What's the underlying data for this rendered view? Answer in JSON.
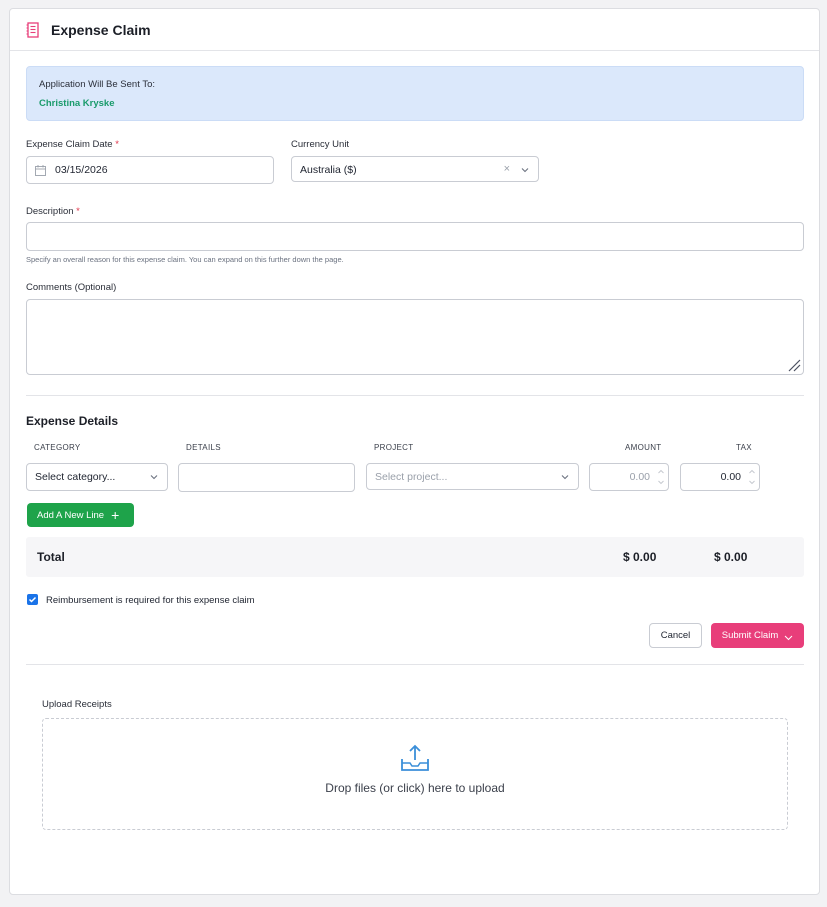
{
  "header": {
    "title": "Expense Claim",
    "icon": "receipt-icon"
  },
  "notice": {
    "label": "Application Will Be Sent To:",
    "recipient": "Christina Kryske"
  },
  "form": {
    "claim_date_label": "Expense Claim Date",
    "required_mark": "*",
    "claim_date_value": "03/15/2026",
    "currency_label": "Currency Unit",
    "currency_value": "Australia ($)",
    "clear_symbol": "×",
    "description_label": "Description",
    "description_value": "",
    "description_help": "Specify an overall reason for this expense claim. You can expand on this further down the page.",
    "comments_label": "Comments (Optional)",
    "comments_value": ""
  },
  "expense_details": {
    "title": "Expense Details",
    "columns": [
      "CATEGORY",
      "DETAILS",
      "PROJECT",
      "AMOUNT",
      "TAX"
    ],
    "row": {
      "category_placeholder": "Select category...",
      "details_value": "",
      "project_placeholder": "Select project...",
      "amount_value": "0.00",
      "tax_value": "0.00"
    },
    "add_line_label": "Add A New Line",
    "total_label": "Total",
    "total_amount": "$ 0.00",
    "total_tax": "$ 0.00"
  },
  "reimbursement": {
    "label": "Reimbursement is required for this expense claim",
    "checked": true
  },
  "actions": {
    "cancel_label": "Cancel",
    "submit_label": "Submit Claim"
  },
  "upload": {
    "label": "Upload Receipts",
    "dropzone_text": "Drop files (or click) here to upload"
  },
  "colors": {
    "accent_pink": "#e83e7a",
    "accent_green": "#1ea34a",
    "link_green": "#1a9b6b",
    "notice_bg": "#dbe8fb",
    "checkbox_blue": "#1a73e8"
  }
}
